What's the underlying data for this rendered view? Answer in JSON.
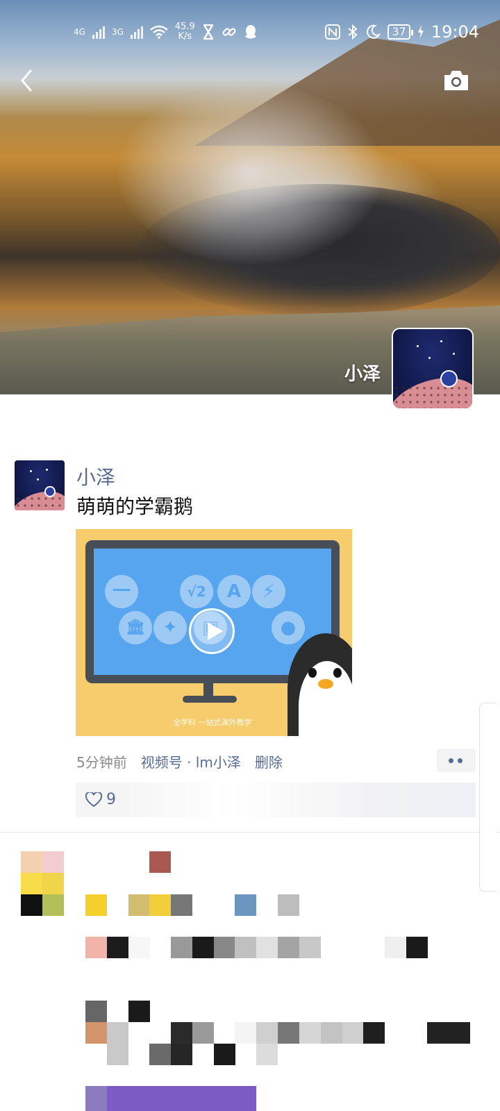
{
  "status_bar": {
    "network1": "4G",
    "network2": "3G",
    "speed_value": "45.9",
    "speed_unit": "K/s",
    "battery": "37",
    "time": "19:04"
  },
  "profile": {
    "name": "小泽"
  },
  "post": {
    "user": "小泽",
    "text": "萌萌的学霸鹅",
    "video_caption": "全学科 一站式课外教学",
    "time_ago": "5分钟前",
    "channel": "视频号 · lm小泽",
    "delete_label": "删除",
    "likes_prefix": "9"
  },
  "colors": {
    "link": "#576b95",
    "text": "#111111",
    "muted": "#8a8a8a",
    "video_bg": "#f6cc6c",
    "screen": "#58a5ef"
  }
}
